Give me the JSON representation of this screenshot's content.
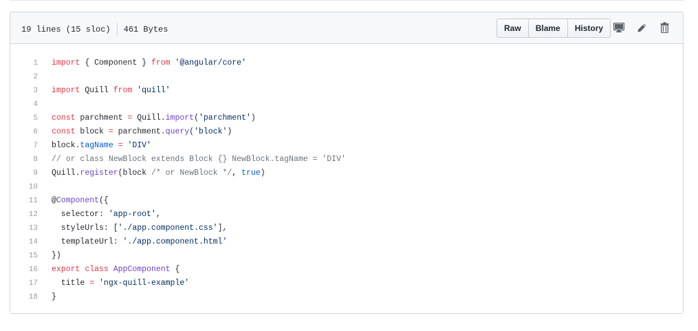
{
  "file": {
    "lines_info": "19 lines (15 sloc)",
    "size_info": "461 Bytes",
    "buttons": {
      "raw": "Raw",
      "blame": "Blame",
      "history": "History"
    },
    "icons": {
      "desktop": "desktop-icon",
      "edit": "pencil-icon",
      "delete": "trash-icon"
    }
  },
  "code": [
    {
      "n": "1",
      "tokens": [
        [
          "k",
          "import"
        ],
        [
          "t",
          " { Component } "
        ],
        [
          "k",
          "from"
        ],
        [
          "t",
          " "
        ],
        [
          "s",
          "'@angular/core'"
        ]
      ]
    },
    {
      "n": "2",
      "tokens": []
    },
    {
      "n": "3",
      "tokens": [
        [
          "k",
          "import"
        ],
        [
          "t",
          " Quill "
        ],
        [
          "k",
          "from"
        ],
        [
          "t",
          " "
        ],
        [
          "s",
          "'quill'"
        ]
      ]
    },
    {
      "n": "4",
      "tokens": []
    },
    {
      "n": "5",
      "tokens": [
        [
          "k",
          "const"
        ],
        [
          "t",
          " parchment "
        ],
        [
          "k",
          "="
        ],
        [
          "t",
          " Quill."
        ],
        [
          "f",
          "import"
        ],
        [
          "t",
          "("
        ],
        [
          "s",
          "'parchment'"
        ],
        [
          "t",
          ")"
        ]
      ]
    },
    {
      "n": "6",
      "tokens": [
        [
          "k",
          "const"
        ],
        [
          "t",
          " block "
        ],
        [
          "k",
          "="
        ],
        [
          "t",
          " parchment."
        ],
        [
          "f",
          "query"
        ],
        [
          "t",
          "("
        ],
        [
          "s",
          "'block'"
        ],
        [
          "t",
          ")"
        ]
      ]
    },
    {
      "n": "7",
      "tokens": [
        [
          "t",
          "block."
        ],
        [
          "p",
          "tagName"
        ],
        [
          "t",
          " "
        ],
        [
          "k",
          "="
        ],
        [
          "t",
          " "
        ],
        [
          "s",
          "'DIV'"
        ]
      ]
    },
    {
      "n": "8",
      "tokens": [
        [
          "c",
          "// or class NewBlock extends Block {} NewBlock.tagName = 'DIV'"
        ]
      ]
    },
    {
      "n": "9",
      "tokens": [
        [
          "t",
          "Quill."
        ],
        [
          "f",
          "register"
        ],
        [
          "t",
          "(block "
        ],
        [
          "c",
          "/* or NewBlock */"
        ],
        [
          "t",
          ", "
        ],
        [
          "p",
          "true"
        ],
        [
          "t",
          ")"
        ]
      ]
    },
    {
      "n": "10",
      "tokens": []
    },
    {
      "n": "11",
      "tokens": [
        [
          "t",
          "@"
        ],
        [
          "f",
          "Component"
        ],
        [
          "t",
          "({"
        ]
      ]
    },
    {
      "n": "12",
      "tokens": [
        [
          "t",
          "  selector: "
        ],
        [
          "s",
          "'app-root'"
        ],
        [
          "t",
          ","
        ]
      ]
    },
    {
      "n": "13",
      "tokens": [
        [
          "t",
          "  styleUrls: ["
        ],
        [
          "s",
          "'./app.component.css'"
        ],
        [
          "t",
          "],"
        ]
      ]
    },
    {
      "n": "14",
      "tokens": [
        [
          "t",
          "  templateUrl: "
        ],
        [
          "s",
          "'./app.component.html'"
        ]
      ]
    },
    {
      "n": "15",
      "tokens": [
        [
          "t",
          "})"
        ]
      ]
    },
    {
      "n": "16",
      "tokens": [
        [
          "k",
          "export"
        ],
        [
          "t",
          " "
        ],
        [
          "k",
          "class"
        ],
        [
          "t",
          " "
        ],
        [
          "f",
          "AppComponent"
        ],
        [
          "t",
          " {"
        ]
      ]
    },
    {
      "n": "17",
      "tokens": [
        [
          "t",
          "  title "
        ],
        [
          "k",
          "="
        ],
        [
          "t",
          " "
        ],
        [
          "s",
          "'ngx-quill-example'"
        ]
      ]
    },
    {
      "n": "18",
      "tokens": [
        [
          "t",
          "}"
        ]
      ]
    }
  ]
}
